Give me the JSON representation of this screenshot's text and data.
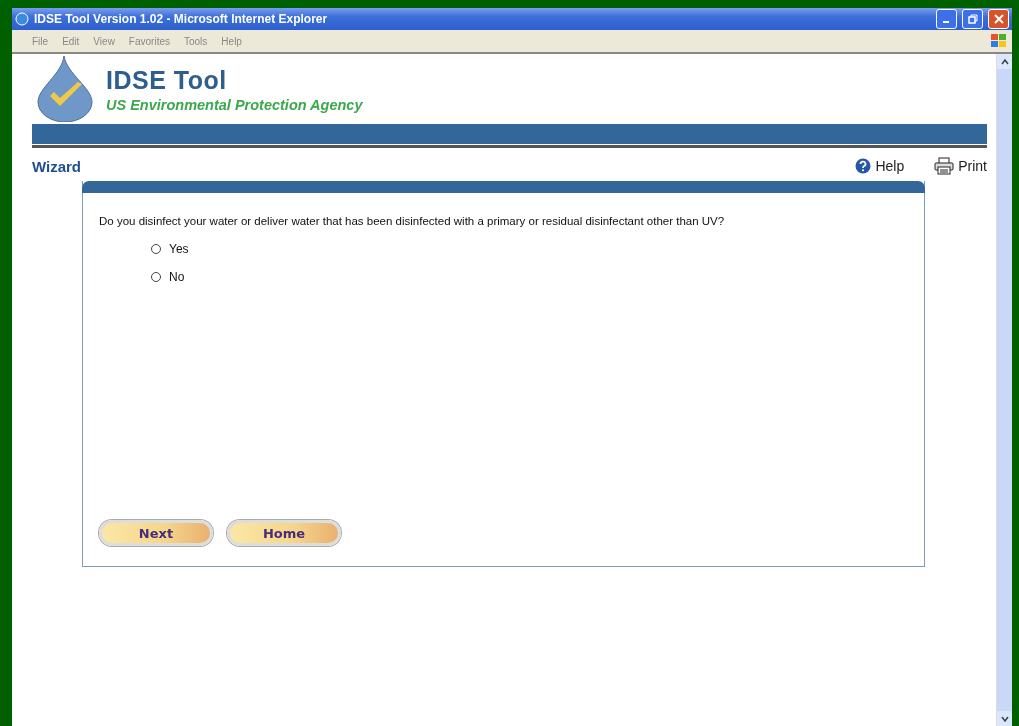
{
  "window": {
    "title": "IDSE Tool Version 1.02 - Microsoft Internet Explorer"
  },
  "menu": [
    "File",
    "Edit",
    "View",
    "Favorites",
    "Tools",
    "Help"
  ],
  "header": {
    "title": "IDSE Tool",
    "subtitle": "US Environmental Protection Agency"
  },
  "page_title": "Wizard",
  "links": [
    {
      "kind": "help",
      "label": "Help"
    },
    {
      "kind": "print",
      "label": "Print"
    }
  ],
  "question": "Do you disinfect your water or deliver water that has been disinfected with a primary or residual disinfectant other than UV?",
  "options": [
    {
      "label": "Yes",
      "selected": false
    },
    {
      "label": "No",
      "selected": false
    }
  ],
  "buttons": [
    "Next",
    "Home"
  ]
}
